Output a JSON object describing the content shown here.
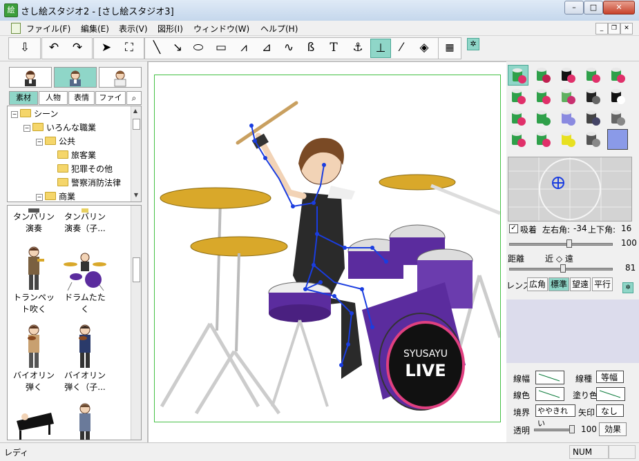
{
  "window": {
    "title": "さし絵スタジオ2 - [さし絵スタジオ3]",
    "app_icon": "絵",
    "min": "–",
    "max": "□",
    "close": "✕"
  },
  "menu": [
    "ファイル(F)",
    "編集(E)",
    "表示(V)",
    "図形(I)",
    "ウィンドウ(W)",
    "ヘルプ(H)"
  ],
  "mdi": {
    "min": "_",
    "restore": "❐",
    "close": "✕"
  },
  "toolbar": {
    "icons": [
      "open-scene-icon",
      "undo-icon",
      "redo-icon",
      "select-arrow-icon",
      "scene-capture-icon",
      "line-icon",
      "arrow-line-icon",
      "ellipse-icon",
      "rectangle-icon",
      "polyline-icon",
      "polygon-icon",
      "curve-icon",
      "closed-curve-icon",
      "text-icon",
      "anchor-icon",
      "move-pose-icon",
      "eyedropper-icon",
      "fill-bucket-icon",
      "image-export-icon",
      "settings-icon"
    ]
  },
  "left": {
    "tabs": [
      "素材",
      "人物",
      "表情",
      "ファイル"
    ],
    "tree": [
      {
        "label": "シーン",
        "indent": 0,
        "exp": "−"
      },
      {
        "label": "いろんな職業",
        "indent": 1,
        "exp": "−"
      },
      {
        "label": "公共",
        "indent": 2,
        "exp": "−"
      },
      {
        "label": "旅客業",
        "indent": 3,
        "exp": ""
      },
      {
        "label": "犯罪その他",
        "indent": 3,
        "exp": ""
      },
      {
        "label": "警察消防法律",
        "indent": 3,
        "exp": ""
      },
      {
        "label": "商業",
        "indent": 2,
        "exp": "−"
      }
    ],
    "thumbs": [
      {
        "l1": "タンバリン",
        "l2": "演奏"
      },
      {
        "l1": "タンバリン",
        "l2": "演奏（子..."
      },
      {
        "l1": "トランペッ",
        "l2": "ト吹く"
      },
      {
        "l1": "ドラムたた",
        "l2": "く"
      },
      {
        "l1": "バイオリン",
        "l2": "弾く"
      },
      {
        "l1": "バイオリン",
        "l2": "弾く（子..."
      },
      {
        "l1": "",
        "l2": ""
      },
      {
        "l1": "",
        "l2": ""
      }
    ]
  },
  "canvas": {
    "drum_logo_1": "SYUSAYU",
    "drum_logo_2": "LIVE"
  },
  "right": {
    "stick_label": "吸着",
    "lr_label": "左右角:",
    "lr_value": "-34",
    "ud_label": "上下角:",
    "ud_value": "16",
    "slider1_value": "100",
    "distance_label": "距離",
    "near_far": "近 ◇ 遠",
    "slider2_value": "81",
    "lens_label": "レンズ",
    "lens": [
      "広角",
      "標準",
      "望遠",
      "平行"
    ],
    "line_width": "線幅",
    "line_type": "線種",
    "line_type_value": "等幅",
    "line_color": "線色",
    "fill_color": "塗り色",
    "border": "境界",
    "border_value": "ややきれい",
    "arrow": "矢印",
    "arrow_value": "なし",
    "opacity": "透明",
    "opacity_value": "100",
    "effect": "効果"
  },
  "status": {
    "text": "レディ",
    "num": "NUM"
  },
  "colors": {
    "accent": "#8fd6c8",
    "drum": "#5b2c9e",
    "cymbal": "#d9a82a",
    "bone": "#1a3de0"
  }
}
